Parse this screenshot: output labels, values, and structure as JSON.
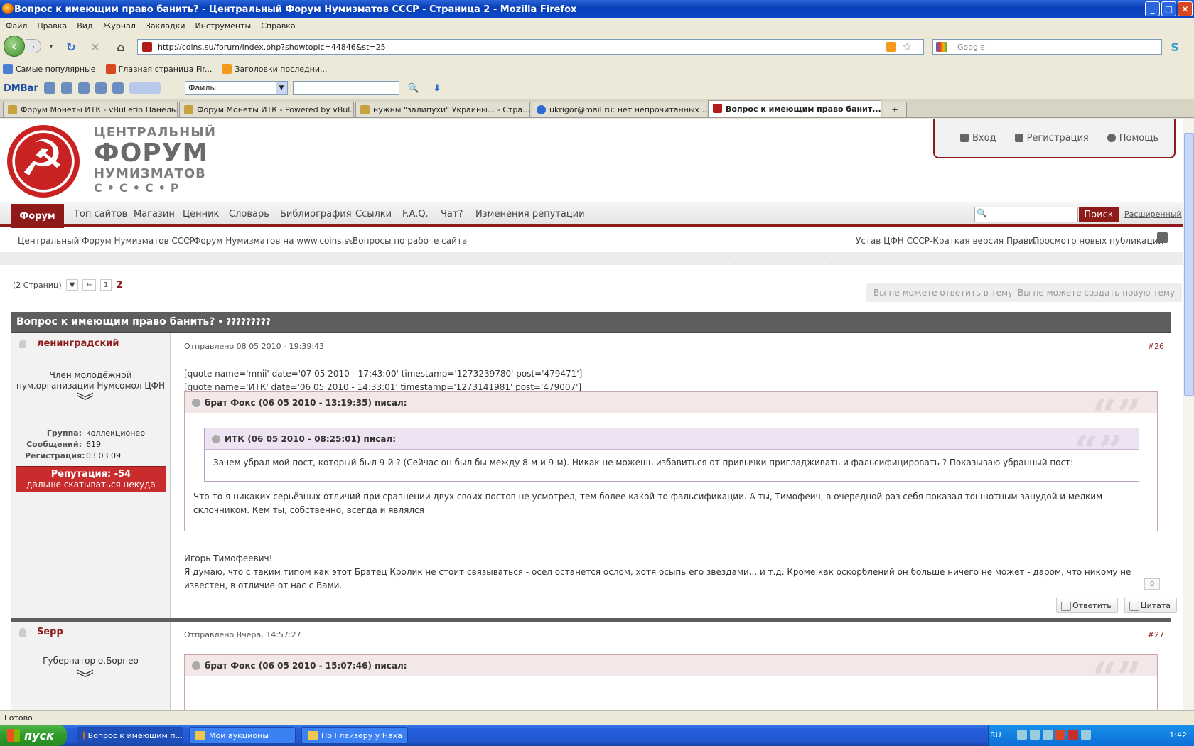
{
  "window": {
    "title": "Вопрос к имеющим право банить? - Центральный Форум Нумизматов СССР - Страница 2 - Mozilla Firefox",
    "buttons": [
      "_",
      "□",
      "✕"
    ]
  },
  "menu": [
    "Файл",
    "Правка",
    "Вид",
    "Журнал",
    "Закладки",
    "Инструменты",
    "Справка"
  ],
  "address": {
    "url": "http://coins.su/forum/index.php?showtopic=44846&st=25",
    "search_placeholder": "Google"
  },
  "bookmarks": [
    {
      "label": "Самые популярные",
      "color": "#4a7fd0"
    },
    {
      "label": "Главная страница Fir...",
      "color": "#d8471f"
    },
    {
      "label": "Заголовки последни...",
      "color": "#f39a1e"
    }
  ],
  "dmbar": {
    "logo": "DMBar",
    "select": "Файлы"
  },
  "tabs": [
    {
      "label": "Форум Монеты ИТК - vBulletin Панель..."
    },
    {
      "label": "Форум Монеты ИТК - Powered by vBul..."
    },
    {
      "label": "нужны \"залипухи\" Украины... - Стра..."
    },
    {
      "label": "ukrigor@mail.ru: нет непрочитанных ..."
    },
    {
      "label": "Вопрос к имеющим право банит..."
    }
  ],
  "site": {
    "logo_lines": [
      "ЦЕНТРАЛЬНЫЙ",
      "ФОРУМ",
      "НУМИЗМАТОВ",
      "С•С•С•Р"
    ],
    "login": "Вход",
    "register": "Регистрация",
    "help": "Помощь",
    "nav": [
      "Форум",
      "Топ сайтов",
      "Магазин",
      "Ценник",
      "Словарь",
      "Библиография",
      "Ссылки",
      "F.A.Q.",
      "Чат?",
      "Изменения репутации"
    ],
    "search_button": "Поиск",
    "advanced": "Расширенный",
    "breadcrumb": [
      "Центральный Форум Нумизматов СССР",
      "Форум Нумизматов на www.coins.su",
      "Вопросы по работе сайта"
    ],
    "crumb_sep": ">",
    "right_links": [
      "Устав ЦФН СССР-Краткая версия Правил",
      "Просмотр новых публикаций"
    ]
  },
  "pager": {
    "pages_label": "(2 Страниц)",
    "prev": "←",
    "page1": "1",
    "current": "2"
  },
  "actions": {
    "no_reply": "Вы не можете ответить в тему",
    "no_new": "Вы не можете создать новую тему"
  },
  "topic": {
    "title": "Вопрос к имеющим право банить?",
    "suffix": "• ?????????"
  },
  "posts": [
    {
      "author": "ленинградский",
      "title": "Член молодёжной нум.организации Нумсомол ЦФН",
      "rank": "︾",
      "group_label": "Группа:",
      "group": "коллекционер",
      "msgs_label": "Сообщений:",
      "msgs": "619",
      "reg_label": "Регистрация:",
      "reg": "03 03 09",
      "rep": "Репутация: -54",
      "rep_note": "дальше скатываться некуда",
      "posted": "Отправлено 08 05 2010 - 19:39:43",
      "num": "#26",
      "raw1": "[quote name='mnii' date='07 05 2010 - 17:43:00' timestamp='1273239780' post='479471']",
      "raw2": "[quote name='ИТК' date='06 05 2010 - 14:33:01' timestamp='1273141981' post='479007']",
      "quote_outer_head": "брат Фокс (06 05 2010 - 13:19:35) писал:",
      "quote_inner_head": "ИТК (06 05 2010 - 08:25:01) писал:",
      "quote_inner_text": "Зачем убрал мой пост, который был 9-й ? (Сейчас он был бы между 8-м и 9-м). Никак не можешь избавиться от привычки пригладживать и фальсифицировать ? Показываю убранный пост:",
      "quote_outer_text": "Что-то я никаких серьёзных отличий при сравнении двух своих постов не усмотрел, тем более какой-то фальсификации. А ты, Тимофеич, в очередной раз себя показал тошнотным занудой и мелким склочником. Кем ты, собственно, всегда и являлся",
      "text1": "Игорь Тимофеевич!",
      "text2": "Я думаю, что с таким типом как этот Братец Кролик не стоит связываться - осел останется ослом, хотя осыпь его звездами... и т.д. Кроме как оскорблений он больше ничего не может - даром, что никому не известен, в отличие от нас с Вами.",
      "votes": "0",
      "reply": "Ответить",
      "cite": "Цитата"
    },
    {
      "author": "Sepp",
      "title": "Губернатор о.Борнео",
      "rank": "︾",
      "posted": "Отправлено Вчера, 14:57:27",
      "num": "#27",
      "quote_outer_head": "брат Фокс (06 05 2010 - 15:07:46) писал:"
    }
  ],
  "status": "Готово",
  "taskbar": {
    "start": "пуск",
    "tasks": [
      "Вопрос к имеющим п...",
      "Мои аукционы",
      "По Глейзеру у Наха"
    ],
    "lang": "RU",
    "clock": "1:42"
  }
}
